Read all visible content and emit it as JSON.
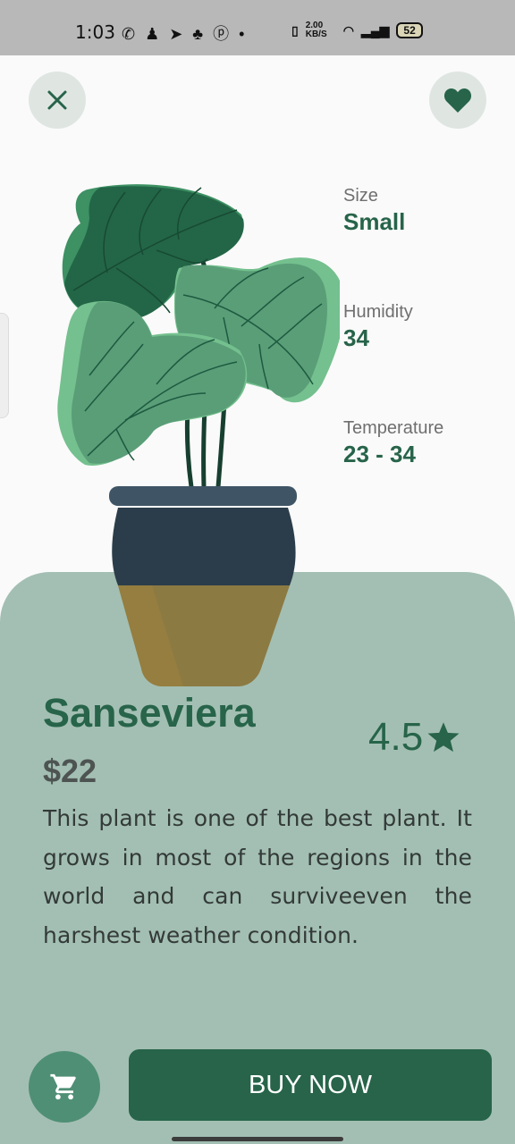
{
  "status_bar": {
    "time": "1:03",
    "net_speed": "2.00 KB/S",
    "battery": "52"
  },
  "colors": {
    "brand_green": "#27644a",
    "panel": "#a3bfb3",
    "leaf_dark": "#236647",
    "leaf_light": "#74c08e",
    "pot": "#2b3d4a",
    "pot_bottom": "#8c7a43"
  },
  "header": {
    "close_icon": "close-icon",
    "favorite_icon": "heart-icon"
  },
  "specs": [
    {
      "label": "Size",
      "value": "Small"
    },
    {
      "label": "Humidity",
      "value": "34"
    },
    {
      "label": "Temperature",
      "value": "23 - 34"
    }
  ],
  "product": {
    "name": "Sanseviera",
    "price": "$22",
    "rating": "4.5",
    "description": "This plant is one of the best plant. It grows in most of the regions in the world and can surviveeven the harshest weather condition."
  },
  "actions": {
    "cart_icon": "cart-icon",
    "buy_label": "BUY NOW"
  }
}
